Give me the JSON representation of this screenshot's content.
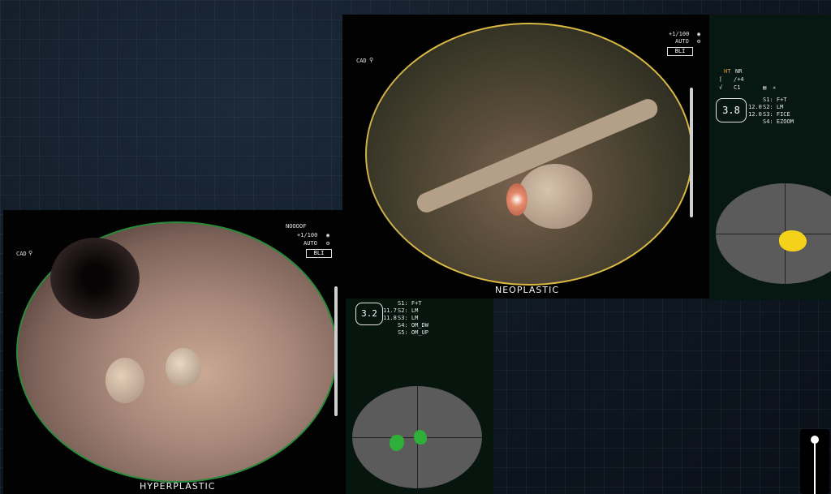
{
  "top_view": {
    "cad_label": "CAD",
    "magnification": "+1/100",
    "mode": "AUTO",
    "light": "BLI",
    "classification": "NEOPLASTIC"
  },
  "top_hud": {
    "ht": "HT",
    "nr": "NR",
    "level": "/+4",
    "c1": "C1",
    "zoom": "3.8",
    "val_a": "12.0",
    "val_b": "12.0",
    "s1": "S1: F+T",
    "s2": "S2: LM",
    "s3": "S3: FICE",
    "s4": "S4: EZOOM",
    "detection_color": "#f4d21a"
  },
  "bottom_view": {
    "cad_label": "CAD",
    "status": "NOOOOF",
    "magnification": "+1/100",
    "mode": "AUTO",
    "light": "BLI",
    "classification": "HYPERPLASTIC"
  },
  "bottom_hud": {
    "zoom": "3.2",
    "val_a": "11.7",
    "val_b": "11.8",
    "s1": "S1: F+T",
    "s2": "S2: LM",
    "s3": "S3: LM",
    "s4": "S4: OM_DW",
    "s5": "S5: OM_UP",
    "detection_color": "#2fae3a"
  }
}
